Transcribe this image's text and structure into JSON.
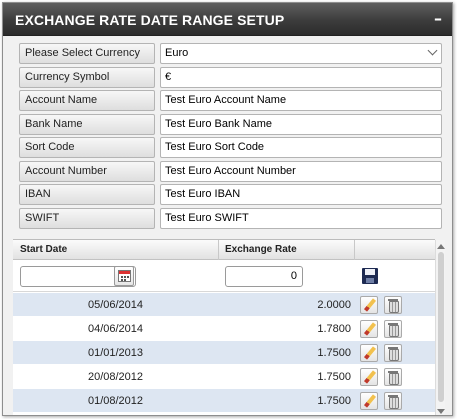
{
  "panel": {
    "title": "EXCHANGE RATE DATE RANGE SETUP",
    "collapse_label": "–"
  },
  "form": {
    "fields": [
      {
        "label": "Please Select Currency",
        "value": "Euro"
      },
      {
        "label": "Currency Symbol",
        "value": "€"
      },
      {
        "label": "Account Name",
        "value": "Test Euro Account Name"
      },
      {
        "label": "Bank Name",
        "value": "Test Euro Bank Name"
      },
      {
        "label": "Sort Code",
        "value": "Test Euro Sort Code"
      },
      {
        "label": "Account Number",
        "value": "Test Euro Account Number"
      },
      {
        "label": "IBAN",
        "value": "Test Euro IBAN"
      },
      {
        "label": "SWIFT",
        "value": "Test Euro SWIFT"
      }
    ]
  },
  "grid": {
    "headers": {
      "start_date": "Start Date",
      "exchange_rate": "Exchange Rate"
    },
    "filter": {
      "start_date": "",
      "exchange_rate": "0"
    },
    "rows": [
      {
        "start_date": "05/06/2014",
        "rate": "2.0000"
      },
      {
        "start_date": "04/06/2014",
        "rate": "1.7800"
      },
      {
        "start_date": "01/01/2013",
        "rate": "1.7500"
      },
      {
        "start_date": "20/08/2012",
        "rate": "1.7500"
      },
      {
        "start_date": "01/08/2012",
        "rate": "1.7500"
      }
    ]
  },
  "icons": {
    "calendar": "calendar-icon",
    "save": "save-icon",
    "edit": "pencil-icon",
    "delete": "trash-icon"
  }
}
